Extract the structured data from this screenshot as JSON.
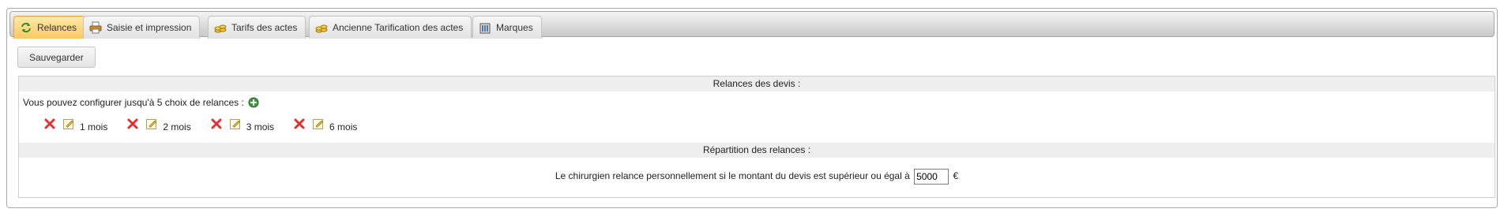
{
  "tabs": [
    {
      "label": "Relances",
      "icon": "refresh-arrows-icon",
      "active": true
    },
    {
      "label": "Saisie et impression",
      "icon": "printer-icon",
      "active": false
    },
    {
      "label": "Tarifs des actes",
      "icon": "coins-icon",
      "active": false
    },
    {
      "label": "Ancienne Tarification des actes",
      "icon": "coins-icon",
      "active": false
    },
    {
      "label": "Marques",
      "icon": "building-icon",
      "active": false
    }
  ],
  "toolbar": {
    "save_label": "Sauvegarder"
  },
  "relances": {
    "header": "Relances des devis :",
    "intro": "Vous pouvez configurer jusqu'à 5 choix de relances :",
    "items": [
      {
        "label": "1 mois"
      },
      {
        "label": "2 mois"
      },
      {
        "label": "3 mois"
      },
      {
        "label": "6 mois"
      }
    ]
  },
  "repartition": {
    "header": "Répartition des relances :",
    "text": "Le chirurgien relance personnellement si le montant du devis est supérieur ou égal à",
    "amount": "5000",
    "currency": "€"
  },
  "colors": {
    "active_tab": "#f9c864",
    "add_icon": "#3c9a3c",
    "delete_icon": "#e03030"
  }
}
